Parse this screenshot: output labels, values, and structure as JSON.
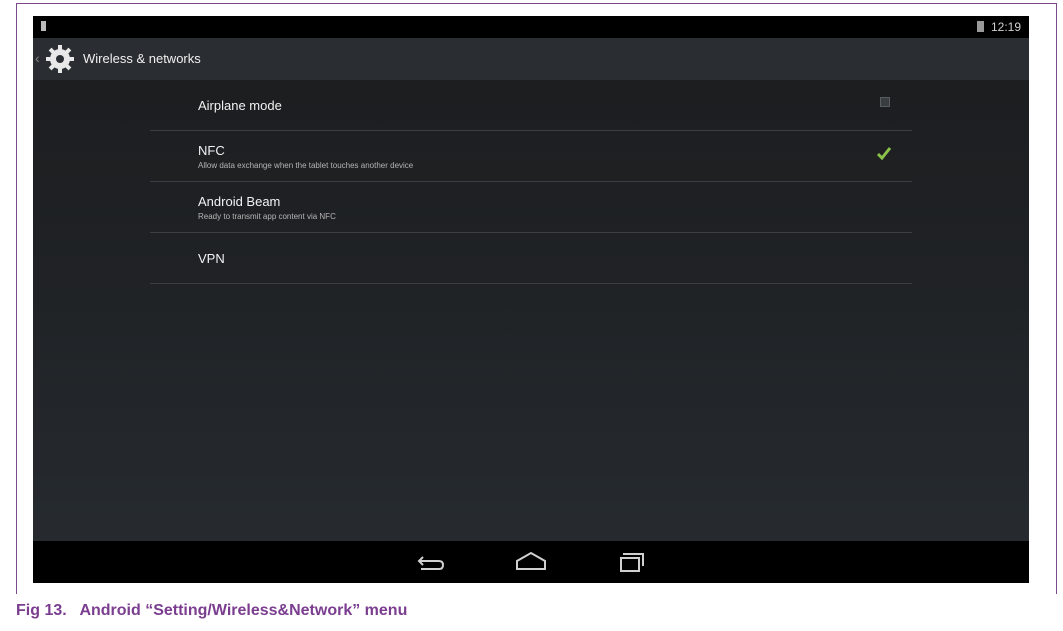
{
  "status_bar": {
    "time": "12:19",
    "battery_icon": "battery-icon",
    "notification_icon": "notification-icon"
  },
  "action_bar": {
    "title": "Wireless & networks",
    "icon": "gear-icon"
  },
  "preferences": [
    {
      "title": "Airplane mode",
      "summary": "",
      "control": "checkbox",
      "checked": false
    },
    {
      "title": "NFC",
      "summary": "Allow data exchange when the tablet touches another device",
      "control": "checkbox",
      "checked": true
    },
    {
      "title": "Android Beam",
      "summary": "Ready to transmit app content via NFC",
      "control": "none"
    },
    {
      "title": "VPN",
      "summary": "",
      "control": "none"
    }
  ],
  "nav_bar": {
    "buttons": [
      "back-icon",
      "home-icon",
      "recents-icon"
    ]
  },
  "caption": {
    "label": "Fig 13.",
    "text": "Android “Setting/Wireless&Network” menu"
  },
  "colors": {
    "accent": "#33b5e5",
    "check": "#8bc34a",
    "caption": "#7a3d8f",
    "frame": "#7a4a8a"
  }
}
